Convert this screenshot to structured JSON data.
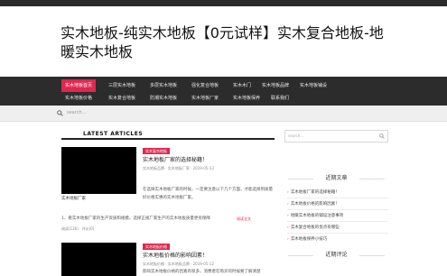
{
  "site": {
    "title": "实木地板-纯实木地板【0元试样】实木复合地板-地暖实木地板"
  },
  "nav": {
    "items": [
      "实木地板首页",
      "三层实木地板",
      "多层实木地板",
      "强化复合地板",
      "实木木门",
      "实木地板品牌",
      "实木地板铺设",
      "实木地板价格",
      "实木复合地板",
      "防潮实木地板",
      "实木地板厂家",
      "实木地板保养",
      "联系我们"
    ]
  },
  "search": {
    "placeholder": "search..."
  },
  "main": {
    "section_title": "LATEST ARTICLES",
    "posts": [
      {
        "category": "实木复合地板",
        "title": "实木地板厂家的选择秘籍！",
        "meta": "实木地板品牌 · 实木地板厂家 · 2019-05-13",
        "excerpt_1": "在选择实木地板厂家的时候，一定要注意以下几个方面，才能选择到质量好价格实惠的实木地板",
        "excerpt_2": "厂家。",
        "thumb_caption": "实木地板厂家",
        "list_line": "1、看实木地板厂家的生产资质和规模，选择正规厂家生产的实木地板质量更有保障",
        "readmore": "阅读全文",
        "footer_meta": "阅读(126) · 评论(0)"
      },
      {
        "category": "实木地板价格",
        "title": "实木地板价格的影响因素！",
        "meta": "实木地板价格 · 实木地板品牌 · 2019-05-12",
        "excerpt_1": "影响实木地板价格的因素有很多，消费者在购买的时候要了解清楚"
      }
    ]
  },
  "sidebar": {
    "search_placeholder": "search...",
    "recent_title": "近期文章",
    "recent": [
      "实木地板厂家的选择秘籍！",
      "实木地板价格的影响因素！",
      "地暖实木地板的铺设注意事项",
      "实木复合地板的优点有哪些",
      "实木地板保养小技巧"
    ],
    "comments_title": "近期评论"
  },
  "colors": {
    "accent": "#e0284f",
    "nav_bg": "#2c2c2c",
    "topbar": "#2b2b2b"
  }
}
